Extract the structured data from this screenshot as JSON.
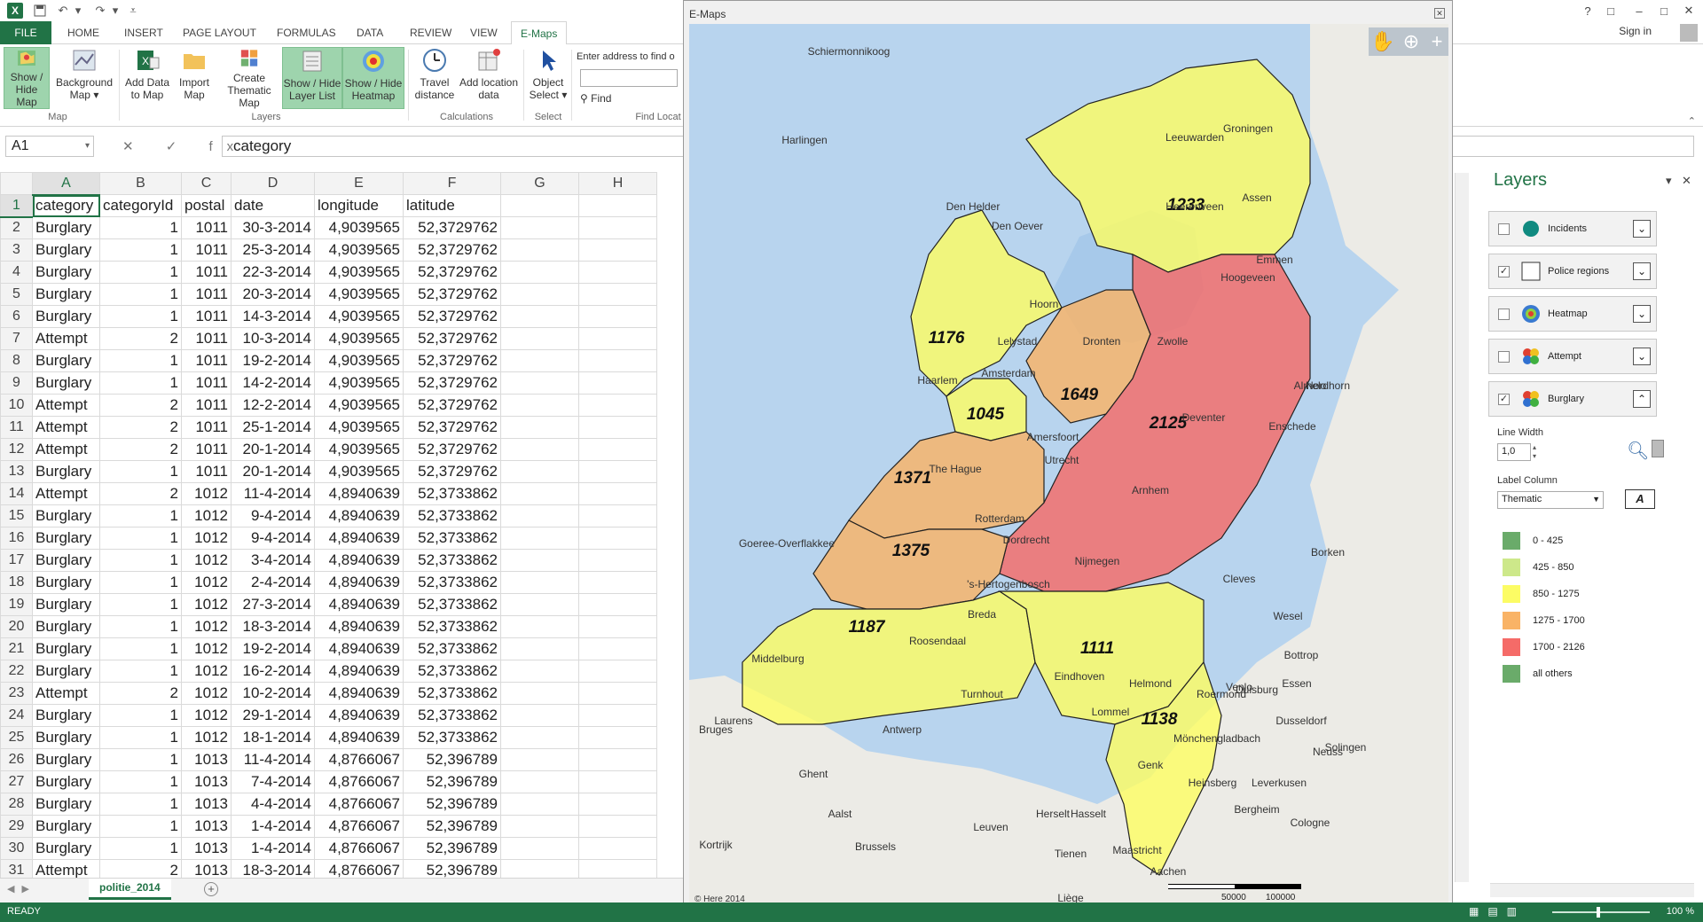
{
  "titlebar": {
    "window_controls": [
      "?",
      "□",
      "–",
      "□",
      "✕"
    ]
  },
  "tabs": [
    "FILE",
    "HOME",
    "INSERT",
    "PAGE LAYOUT",
    "FORMULAS",
    "DATA",
    "REVIEW",
    "VIEW",
    "E-Maps"
  ],
  "signin": "Sign in",
  "ribbon": {
    "show_hide_map": "Show / Hide Map",
    "background_map": "Background Map ▾",
    "add_data": "Add Data to Map",
    "import_map": "Import Map",
    "create_thematic": "Create Thematic Map",
    "show_layer_list": "Show / Hide Layer List",
    "show_heatmap": "Show / Hide Heatmap",
    "travel_distance": "Travel distance",
    "add_location": "Add location data",
    "object_select": "Object Select ▾",
    "find_label": "Enter address to find o",
    "find_button": "Find",
    "groups": {
      "map": "Map",
      "layers": "Layers",
      "calculations": "Calculations",
      "select": "Select",
      "find": "Find Locat"
    }
  },
  "formula": {
    "name_box": "A1",
    "fx_icons": "✕ ✓ fx",
    "value": "category"
  },
  "sheet": {
    "columns": [
      "A",
      "B",
      "C",
      "D",
      "E",
      "F",
      "G",
      "H"
    ],
    "rows": [
      [
        "category",
        "categoryId",
        "postal",
        "date",
        "longitude",
        "latitude"
      ],
      [
        "Burglary",
        "1",
        "1011",
        "30-3-2014",
        "4,9039565",
        "52,3729762"
      ],
      [
        "Burglary",
        "1",
        "1011",
        "25-3-2014",
        "4,9039565",
        "52,3729762"
      ],
      [
        "Burglary",
        "1",
        "1011",
        "22-3-2014",
        "4,9039565",
        "52,3729762"
      ],
      [
        "Burglary",
        "1",
        "1011",
        "20-3-2014",
        "4,9039565",
        "52,3729762"
      ],
      [
        "Burglary",
        "1",
        "1011",
        "14-3-2014",
        "4,9039565",
        "52,3729762"
      ],
      [
        "Attempt",
        "2",
        "1011",
        "10-3-2014",
        "4,9039565",
        "52,3729762"
      ],
      [
        "Burglary",
        "1",
        "1011",
        "19-2-2014",
        "4,9039565",
        "52,3729762"
      ],
      [
        "Burglary",
        "1",
        "1011",
        "14-2-2014",
        "4,9039565",
        "52,3729762"
      ],
      [
        "Attempt",
        "2",
        "1011",
        "12-2-2014",
        "4,9039565",
        "52,3729762"
      ],
      [
        "Attempt",
        "2",
        "1011",
        "25-1-2014",
        "4,9039565",
        "52,3729762"
      ],
      [
        "Attempt",
        "2",
        "1011",
        "20-1-2014",
        "4,9039565",
        "52,3729762"
      ],
      [
        "Burglary",
        "1",
        "1011",
        "20-1-2014",
        "4,9039565",
        "52,3729762"
      ],
      [
        "Attempt",
        "2",
        "1012",
        "11-4-2014",
        "4,8940639",
        "52,3733862"
      ],
      [
        "Burglary",
        "1",
        "1012",
        "9-4-2014",
        "4,8940639",
        "52,3733862"
      ],
      [
        "Burglary",
        "1",
        "1012",
        "9-4-2014",
        "4,8940639",
        "52,3733862"
      ],
      [
        "Burglary",
        "1",
        "1012",
        "3-4-2014",
        "4,8940639",
        "52,3733862"
      ],
      [
        "Burglary",
        "1",
        "1012",
        "2-4-2014",
        "4,8940639",
        "52,3733862"
      ],
      [
        "Burglary",
        "1",
        "1012",
        "27-3-2014",
        "4,8940639",
        "52,3733862"
      ],
      [
        "Burglary",
        "1",
        "1012",
        "18-3-2014",
        "4,8940639",
        "52,3733862"
      ],
      [
        "Burglary",
        "1",
        "1012",
        "19-2-2014",
        "4,8940639",
        "52,3733862"
      ],
      [
        "Burglary",
        "1",
        "1012",
        "16-2-2014",
        "4,8940639",
        "52,3733862"
      ],
      [
        "Attempt",
        "2",
        "1012",
        "10-2-2014",
        "4,8940639",
        "52,3733862"
      ],
      [
        "Burglary",
        "1",
        "1012",
        "29-1-2014",
        "4,8940639",
        "52,3733862"
      ],
      [
        "Burglary",
        "1",
        "1012",
        "18-1-2014",
        "4,8940639",
        "52,3733862"
      ],
      [
        "Burglary",
        "1",
        "1013",
        "11-4-2014",
        "4,8766067",
        "52,396789"
      ],
      [
        "Burglary",
        "1",
        "1013",
        "7-4-2014",
        "4,8766067",
        "52,396789"
      ],
      [
        "Burglary",
        "1",
        "1013",
        "4-4-2014",
        "4,8766067",
        "52,396789"
      ],
      [
        "Burglary",
        "1",
        "1013",
        "1-4-2014",
        "4,8766067",
        "52,396789"
      ],
      [
        "Burglary",
        "1",
        "1013",
        "1-4-2014",
        "4,8766067",
        "52,396789"
      ],
      [
        "Attempt",
        "2",
        "1013",
        "18-3-2014",
        "4,8766067",
        "52,396789"
      ]
    ]
  },
  "sheet_tab": "politie_2014",
  "status": {
    "ready": "READY",
    "zoom": "100 %"
  },
  "emaps": {
    "title": "E-Maps",
    "close": "✕",
    "copyright": "© Here 2014",
    "scale": [
      "50000",
      "100000"
    ],
    "region_values": [
      "1233",
      "1176",
      "1649",
      "1045",
      "2125",
      "1371",
      "1375",
      "1187",
      "1111",
      "1138"
    ],
    "colors": {
      "c0": "#6aab6a",
      "c1": "#cde88a",
      "c2": "#fcfc64",
      "c3": "#f9b366",
      "c4": "#f56b68"
    },
    "cities": [
      "Leeuwarden",
      "Groningen",
      "Heerenveen",
      "Assen",
      "Emmen",
      "Hoogeveen",
      "Den Helder",
      "Den Oever",
      "Hoorn",
      "Lelystad",
      "Dronten",
      "Zwolle",
      "Almelo",
      "Haarlem",
      "Amsterdam",
      "Deventer",
      "Enschede",
      "Amersfoort",
      "Utrecht",
      "The Hague",
      "Rotterdam",
      "Arnhem",
      "Dordrecht",
      "Goeree-Overflakkee",
      "Nijmegen",
      "'s-Hertogenbosch",
      "Breda",
      "Roosendaal",
      "Middelburg",
      "Eindhoven",
      "Helmond",
      "Antwerp",
      "Bruges",
      "Ghent",
      "Aalst",
      "Brussels",
      "Leuven",
      "Hasselt",
      "Maastricht",
      "Aachen",
      "Dusseldorf",
      "Duisburg",
      "Essen",
      "Bottrop",
      "Wesel",
      "Cleves",
      "Venlo",
      "Neuss",
      "Mönchengladbach",
      "Heinsberg",
      "Cologne",
      "Kortrijk",
      "Liège",
      "Harlingen",
      "Schiermonnikoog",
      "Borken",
      "Nordhorn",
      "Turnhout",
      "Herselt",
      "Laurens",
      "Roermond",
      "Lommel",
      "Genk",
      "Tienen",
      "Solingen",
      "Bergheim",
      "Leverkusen"
    ]
  },
  "layers": {
    "title": "Layers",
    "items": [
      {
        "name": "Incidents",
        "checked": ""
      },
      {
        "name": "Police regions",
        "checked": "✓"
      },
      {
        "name": "Heatmap",
        "checked": ""
      },
      {
        "name": "Attempt",
        "checked": ""
      },
      {
        "name": "Burglary",
        "checked": "✓"
      }
    ],
    "line_width_label": "Line Width",
    "line_width_value": "1,0",
    "label_column_label": "Label Column",
    "label_column_value": "Thematic",
    "format_button": "A",
    "legend": [
      {
        "label": "0 - 425",
        "color": "#6aab6a"
      },
      {
        "label": "425 - 850",
        "color": "#cde88a"
      },
      {
        "label": "850 - 1275",
        "color": "#fcfc64"
      },
      {
        "label": "1275 - 1700",
        "color": "#f9b366"
      },
      {
        "label": "1700 - 2126",
        "color": "#f56b68"
      },
      {
        "label": "all others",
        "color": "#6aab6a"
      }
    ]
  }
}
